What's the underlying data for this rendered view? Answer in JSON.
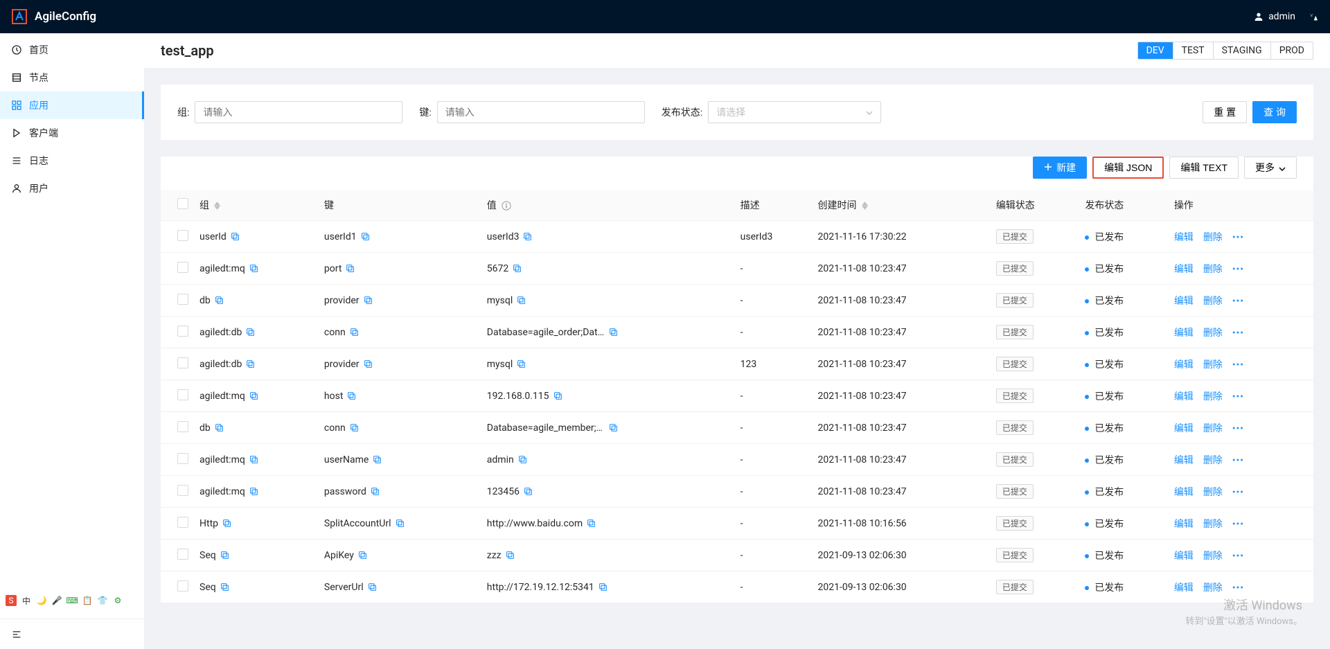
{
  "brand": "AgileConfig",
  "user": {
    "name": "admin"
  },
  "sidebar": {
    "items": [
      {
        "label": "首页"
      },
      {
        "label": "节点"
      },
      {
        "label": "应用"
      },
      {
        "label": "客户端"
      },
      {
        "label": "日志"
      },
      {
        "label": "用户"
      }
    ]
  },
  "page": {
    "title": "test_app",
    "envs": [
      "DEV",
      "TEST",
      "STAGING",
      "PROD"
    ],
    "activeEnv": "DEV"
  },
  "filter": {
    "groupLabel": "组:",
    "groupPlaceholder": "请输入",
    "keyLabel": "键:",
    "keyPlaceholder": "请输入",
    "statusLabel": "发布状态:",
    "statusPlaceholder": "请选择",
    "reset": "重 置",
    "query": "查 询"
  },
  "toolbar": {
    "new": "新建",
    "editJson": "编辑 JSON",
    "editText": "编辑 TEXT",
    "more": "更多"
  },
  "table": {
    "columns": {
      "group": "组",
      "key": "键",
      "value": "值",
      "desc": "描述",
      "created": "创建时间",
      "editStatus": "编辑状态",
      "pubStatus": "发布状态",
      "actions": "操作"
    },
    "actionLabels": {
      "edit": "编辑",
      "delete": "删除"
    },
    "editStatusTag": "已提交",
    "pubStatusText": "已发布",
    "rows": [
      {
        "group": "userId",
        "key": "userId1",
        "value": "userId3",
        "desc": "userId3",
        "created": "2021-11-16 17:30:22"
      },
      {
        "group": "agiledt:mq",
        "key": "port",
        "value": "5672",
        "desc": "-",
        "created": "2021-11-08 10:23:47"
      },
      {
        "group": "db",
        "key": "provider",
        "value": "mysql",
        "desc": "-",
        "created": "2021-11-08 10:23:47"
      },
      {
        "group": "agiledt:db",
        "key": "conn",
        "value": "Database=agile_order;Data S...",
        "desc": "-",
        "created": "2021-11-08 10:23:47"
      },
      {
        "group": "agiledt:db",
        "key": "provider",
        "value": "mysql",
        "desc": "123",
        "created": "2021-11-08 10:23:47"
      },
      {
        "group": "agiledt:mq",
        "key": "host",
        "value": "192.168.0.115",
        "desc": "-",
        "created": "2021-11-08 10:23:47"
      },
      {
        "group": "db",
        "key": "conn",
        "value": "Database=agile_member;Data...",
        "desc": "-",
        "created": "2021-11-08 10:23:47"
      },
      {
        "group": "agiledt:mq",
        "key": "userName",
        "value": "admin",
        "desc": "-",
        "created": "2021-11-08 10:23:47"
      },
      {
        "group": "agiledt:mq",
        "key": "password",
        "value": "123456",
        "desc": "-",
        "created": "2021-11-08 10:23:47"
      },
      {
        "group": "Http",
        "key": "SplitAccountUrl",
        "value": "http://www.baidu.com",
        "desc": "-",
        "created": "2021-11-08 10:16:56"
      },
      {
        "group": "Seq",
        "key": "ApiKey",
        "value": "zzz",
        "desc": "-",
        "created": "2021-09-13 02:06:30"
      },
      {
        "group": "Seq",
        "key": "ServerUrl",
        "value": "http://172.19.12.12:5341",
        "desc": "-",
        "created": "2021-09-13 02:06:30"
      }
    ]
  },
  "watermark": {
    "line1": "激活 Windows",
    "line2": "转到\"设置\"以激活 Windows。"
  }
}
